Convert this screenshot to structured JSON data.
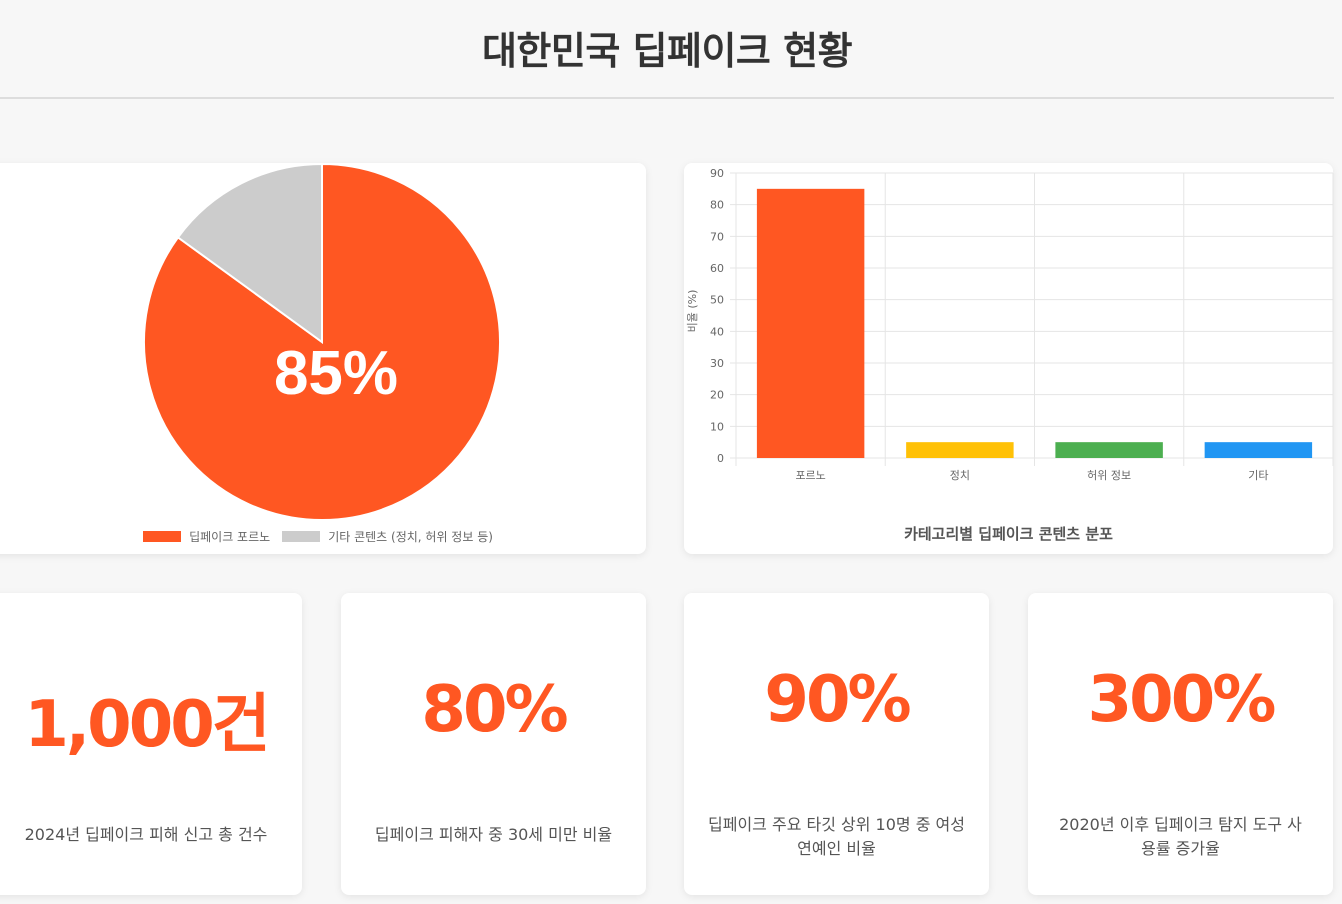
{
  "page": {
    "title": "대한민국 딥페이크 현황"
  },
  "pie_chart": {
    "center_label": "85%",
    "legend": [
      "딥페이크 포르노",
      "기타 콘텐츠 (정치, 허위 정보 등)"
    ]
  },
  "bar_chart": {
    "caption": "카테고리별 딥페이크 콘텐츠 분포"
  },
  "chart_data": [
    {
      "type": "pie",
      "labels": [
        "딥페이크 포르노",
        "기타 콘텐츠 (정치, 허위 정보 등)"
      ],
      "values": [
        85,
        15
      ],
      "colors": [
        "#ff5722",
        "#cccccc"
      ],
      "legend_position": "bottom"
    },
    {
      "type": "bar",
      "categories": [
        "포르노",
        "정치",
        "허위 정보",
        "기타"
      ],
      "values": [
        85,
        5,
        5,
        5
      ],
      "colors": [
        "#ff5722",
        "#ffc107",
        "#4caf50",
        "#2196f3"
      ],
      "ylabel": "비율 (%)",
      "ylim": [
        0,
        90
      ],
      "yticks": [
        0,
        10,
        20,
        30,
        40,
        50,
        60,
        70,
        80,
        90
      ],
      "grid": true,
      "title": "카테고리별 딥페이크 콘텐츠 분포"
    }
  ],
  "stats": [
    {
      "value": "1,000건",
      "desc": "2024년 딥페이크 피해 신고 총 건수"
    },
    {
      "value": "80%",
      "desc": "딥페이크 피해자 중 30세 미만 비율"
    },
    {
      "value": "90%",
      "desc": "딥페이크 주요 타깃 상위 10명 중 여성 연예인 비율"
    },
    {
      "value": "300%",
      "desc": "2020년 이후 딥페이크 탐지 도구 사용률 증가율"
    }
  ],
  "colors": {
    "accent": "#ff5722",
    "background": "#f7f7f7"
  }
}
